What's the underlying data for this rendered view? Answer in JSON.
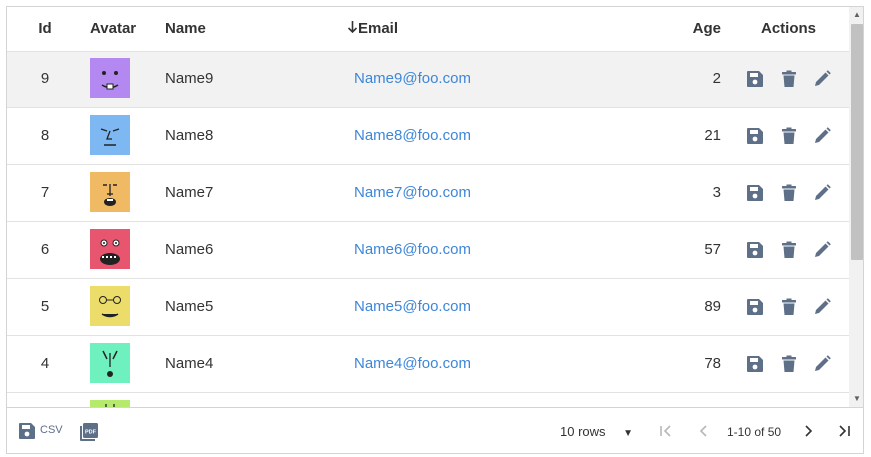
{
  "columns": {
    "id": "Id",
    "avatar": "Avatar",
    "name": "Name",
    "email": "Email",
    "email_sort_icon": "arrow-down-icon",
    "age": "Age",
    "actions": "Actions"
  },
  "rows": [
    {
      "id": "9",
      "name": "Name9",
      "email": "Name9@foo.com",
      "age": "2",
      "avatar_color": "#b388f0",
      "selected": true
    },
    {
      "id": "8",
      "name": "Name8",
      "email": "Name8@foo.com",
      "age": "21",
      "avatar_color": "#7db8f2"
    },
    {
      "id": "7",
      "name": "Name7",
      "email": "Name7@foo.com",
      "age": "3",
      "avatar_color": "#f0b964"
    },
    {
      "id": "6",
      "name": "Name6",
      "email": "Name6@foo.com",
      "age": "57",
      "avatar_color": "#e8556e"
    },
    {
      "id": "5",
      "name": "Name5",
      "email": "Name5@foo.com",
      "age": "89",
      "avatar_color": "#ecdd6a"
    },
    {
      "id": "4",
      "name": "Name4",
      "email": "Name4@foo.com",
      "age": "78",
      "avatar_color": "#6ff0bf"
    },
    {
      "id": "",
      "name": "",
      "email": "",
      "age": "",
      "avatar_color": "#b5ea6c"
    }
  ],
  "actions": [
    "save-icon",
    "delete-icon",
    "edit-icon"
  ],
  "footer": {
    "csv_label": "CSV",
    "pdf_icon": "pdf-icon",
    "rows_per_page": "10 rows",
    "range": "1-10 of 50"
  },
  "colors": {
    "accent": "#3d86d8",
    "icon": "#5e6f88",
    "border": "#e2e2e2",
    "selected_row": "#f2f2f2"
  }
}
